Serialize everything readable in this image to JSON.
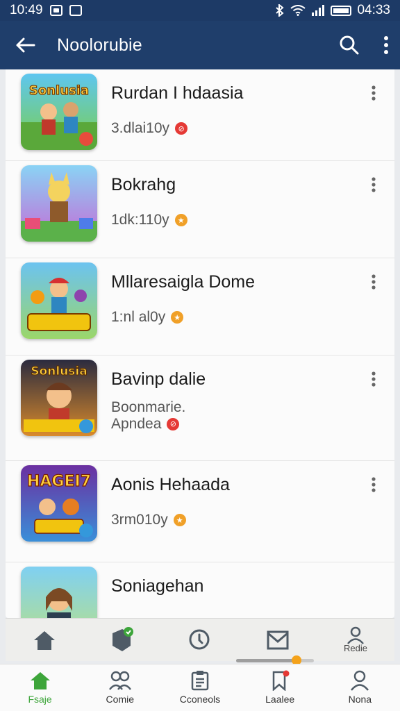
{
  "status": {
    "time_left": "10:49",
    "time_right": "04:33"
  },
  "app_bar": {
    "title": "Noolorubie"
  },
  "items": [
    {
      "title": "Rurdan I hdaasia",
      "subtitle": "3.dlai10y",
      "badge_color": "#e53935",
      "badge_icon": "ban-icon"
    },
    {
      "title": "Bokrahg",
      "subtitle": "1dk:110y",
      "badge_color": "#f0a028",
      "badge_icon": "star-icon"
    },
    {
      "title": "Mllaresaigla Dome",
      "subtitle": "1:nl al0y",
      "badge_color": "#f0a028",
      "badge_icon": "star-icon"
    },
    {
      "title": "Bavinp dalie",
      "subtitle_line1": "Boonmarie.",
      "subtitle_line2": "Apndea",
      "badge_color": "#e53935",
      "badge_icon": "ban-icon"
    },
    {
      "title": "Aonis Hehaada",
      "subtitle": "3rm010y",
      "badge_color": "#f0a028",
      "badge_icon": "star-icon"
    },
    {
      "title": "Soniagehan"
    }
  ],
  "thumb_texts": [
    "Sonlusia",
    "Sonlusia",
    "HAGEI7"
  ],
  "bottom_nav_top": {
    "profile_label": "Redie"
  },
  "progress": {
    "value": 0.78
  },
  "bottom_nav": [
    {
      "label": "Fsaje",
      "icon": "home-icon"
    },
    {
      "label": "Comie",
      "icon": "people-icon"
    },
    {
      "label": "Cconeols",
      "icon": "clipboard-icon"
    },
    {
      "label": "Laalee",
      "icon": "bookmark-icon"
    },
    {
      "label": "Nona",
      "icon": "person-icon"
    }
  ],
  "colors": {
    "app_bar": "#1f3e6b",
    "status_bar": "#1d3a66",
    "active": "#3da53a",
    "accent": "#f4a21a"
  }
}
